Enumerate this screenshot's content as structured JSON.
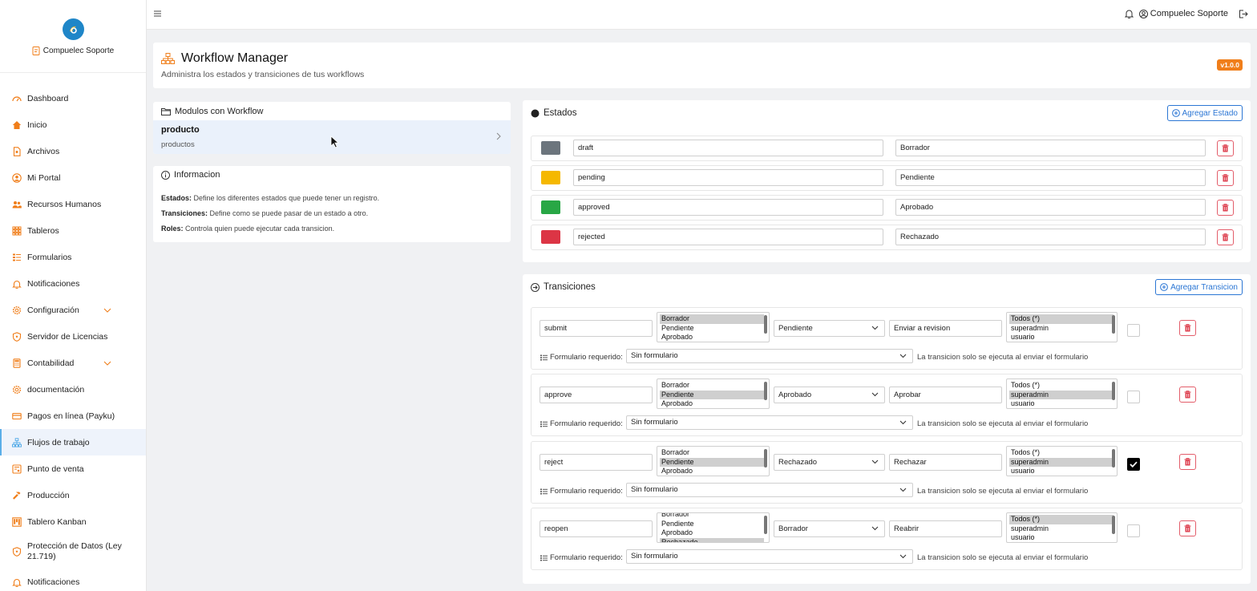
{
  "sidebar": {
    "brand_name": "Compuelec Soporte",
    "items": [
      {
        "label": "Dashboard",
        "icon": "dashboard-icon"
      },
      {
        "label": "Inicio",
        "icon": "home-icon"
      },
      {
        "label": "Archivos",
        "icon": "file-icon"
      },
      {
        "label": "Mi Portal",
        "icon": "user-circle-icon"
      },
      {
        "label": "Recursos Humanos",
        "icon": "people-icon"
      },
      {
        "label": "Tableros",
        "icon": "grid-icon"
      },
      {
        "label": "Formularios",
        "icon": "form-icon"
      },
      {
        "label": "Notificaciones",
        "icon": "bell-icon"
      },
      {
        "label": "Configuración",
        "icon": "gear-icon",
        "expandable": true
      },
      {
        "label": "Servidor de Licencias",
        "icon": "shield-icon"
      },
      {
        "label": "Contabilidad",
        "icon": "calculator-icon",
        "expandable": true
      },
      {
        "label": "documentación",
        "icon": "gear-icon"
      },
      {
        "label": "Pagos en línea (Payku)",
        "icon": "card-icon"
      },
      {
        "label": "Flujos de trabajo",
        "icon": "workflow-icon",
        "active": true
      },
      {
        "label": "Punto de venta",
        "icon": "pos-icon"
      },
      {
        "label": "Producción",
        "icon": "hammer-icon"
      },
      {
        "label": "Tablero Kanban",
        "icon": "kanban-icon"
      },
      {
        "label": "Protección de Datos (Ley 21.719)",
        "icon": "shield-icon"
      },
      {
        "label": "Notificaciones",
        "icon": "bell-icon"
      }
    ]
  },
  "topbar": {
    "user_name": "Compuelec Soporte"
  },
  "header": {
    "title": "Workflow Manager",
    "subtitle": "Administra los estados y transiciones de tus workflows",
    "version": "v1.0.0"
  },
  "modules": {
    "title": "Modulos con Workflow",
    "items": [
      {
        "name": "producto",
        "table": "productos"
      }
    ]
  },
  "info": {
    "title": "Informacion",
    "lines": [
      {
        "term": "Estados:",
        "text": " Define los diferentes estados que puede tener un registro."
      },
      {
        "term": "Transiciones:",
        "text": " Define como se puede pasar de un estado a otro."
      },
      {
        "term": "Roles:",
        "text": " Controla quien puede ejecutar cada transicion."
      }
    ]
  },
  "estados": {
    "title": "Estados",
    "add_label": "Agregar Estado",
    "rows": [
      {
        "key": "draft",
        "label": "Borrador",
        "color": "#6c757d"
      },
      {
        "key": "pending",
        "label": "Pendiente",
        "color": "#f5b800"
      },
      {
        "key": "approved",
        "label": "Aprobado",
        "color": "#28a745"
      },
      {
        "key": "rejected",
        "label": "Rechazado",
        "color": "#dc3545"
      }
    ]
  },
  "transiciones": {
    "title": "Transiciones",
    "add_label": "Agregar Transicion",
    "form_label": "Formulario requerido:",
    "form_note": "La transicion solo se ejecuta al enviar el formulario",
    "rows": [
      {
        "name": "submit",
        "from": [
          "Borrador",
          "Pendiente",
          "Aprobado"
        ],
        "from_selected": 0,
        "to": "Pendiente",
        "action": "Enviar a revision",
        "roles": [
          "Todos (*)",
          "superadmin",
          "usuario"
        ],
        "roles_selected": 0,
        "checked": false,
        "form": "Sin formulario"
      },
      {
        "name": "approve",
        "from": [
          "Borrador",
          "Pendiente",
          "Aprobado"
        ],
        "from_selected": 1,
        "to": "Aprobado",
        "action": "Aprobar",
        "roles": [
          "Todos (*)",
          "superadmin",
          "usuario"
        ],
        "roles_selected": 1,
        "checked": false,
        "form": "Sin formulario"
      },
      {
        "name": "reject",
        "from": [
          "Borrador",
          "Pendiente",
          "Aprobado"
        ],
        "from_selected": 1,
        "to": "Rechazado",
        "action": "Rechazar",
        "roles": [
          "Todos (*)",
          "superadmin",
          "usuario"
        ],
        "roles_selected": 1,
        "checked": true,
        "form": "Sin formulario"
      },
      {
        "name": "reopen",
        "from": [
          "Borrador",
          "Pendiente",
          "Aprobado",
          "Rechazado"
        ],
        "from_selected": 3,
        "to": "Borrador",
        "action": "Reabrir",
        "roles": [
          "Todos (*)",
          "superadmin",
          "usuario"
        ],
        "roles_selected": 0,
        "checked": false,
        "form": "Sin formulario"
      }
    ]
  },
  "colors": {
    "accent": "#f07e1a",
    "primary": "#2b76d4",
    "danger": "#dc3545"
  }
}
